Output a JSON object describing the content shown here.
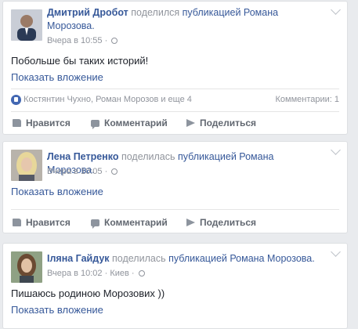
{
  "posts": [
    {
      "author": "Дмитрий Дробот",
      "action_text": "поделился",
      "link_text": "публикацией Романа Морозова",
      "link_tail": "Морозова.",
      "time": "Вчера в 10:55",
      "location": "",
      "text": "Побольше бы таких историй!",
      "show_attachment": "Показать вложение",
      "likes": "Костянтин Чухно, Роман Морозов и еще 4",
      "comments_count": "Комментарии: 1"
    },
    {
      "author": "Лена Петренко",
      "action_text": "поделилась",
      "link_text": "публикацией Романа Морозова.",
      "time": "Вчера в 10:05",
      "location": "",
      "text": "",
      "show_attachment": "Показать вложение"
    },
    {
      "author": "Іляна Гайдук",
      "action_text": "поделилась",
      "link_text": "публикацией Романа Морозова.",
      "time": "Вчера в 10:02",
      "location": "Киев",
      "text": "Пишаюсь родиною Морозових ))",
      "show_attachment": "Показать вложение"
    }
  ],
  "actions": {
    "like": "Нравится",
    "comment": "Комментарий",
    "share": "Поделиться"
  },
  "separator": "·",
  "icons": [
    "chevron-down-icon",
    "globe-icon",
    "like-icon",
    "comment-icon",
    "share-icon"
  ],
  "colors": {
    "link": "#365899",
    "muted": "#90949c",
    "like_blue": "#4267b2"
  }
}
